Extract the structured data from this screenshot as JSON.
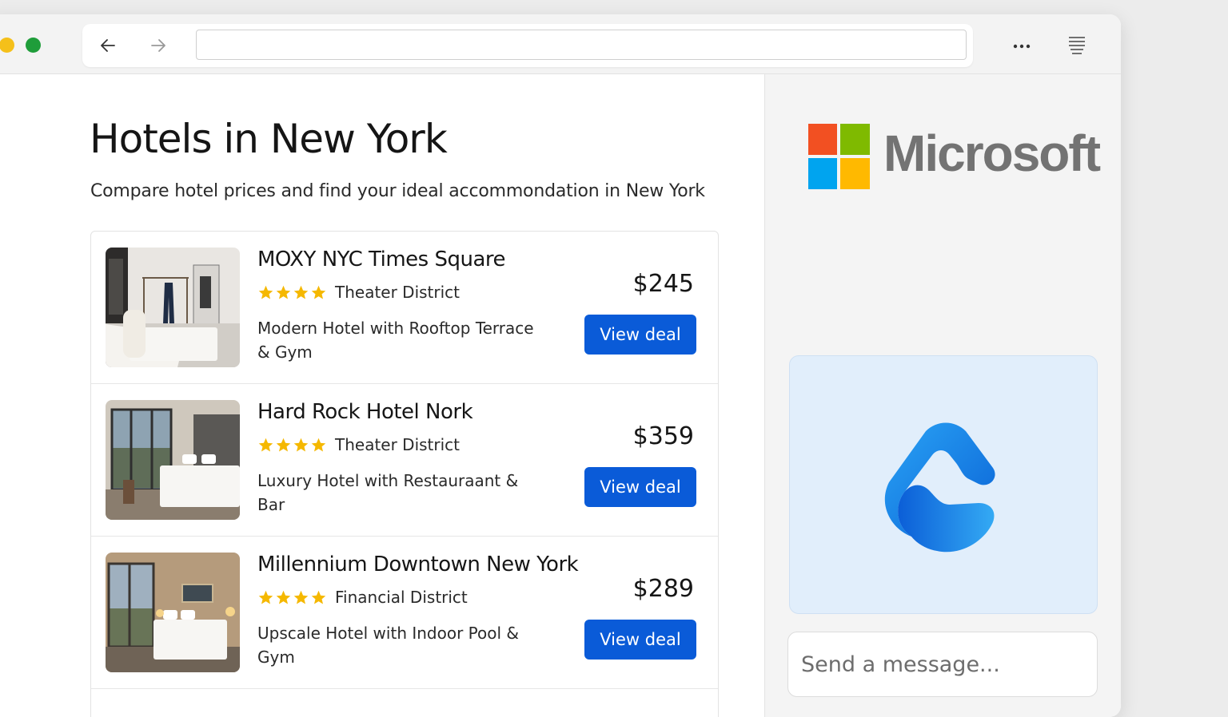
{
  "browser": {
    "address_value": "",
    "icons": [
      "back-arrow-icon",
      "forward-arrow-icon",
      "more-icon",
      "reader-icon"
    ]
  },
  "page": {
    "title": "Hotels in New York",
    "subtitle": "Compare hotel prices and find your ideal accommondation in New York"
  },
  "hotels": [
    {
      "name": "MOXY NYC Times Square",
      "stars": 4,
      "district": "Theater District",
      "description": "Modern Hotel with Rooftop Terrace & Gym",
      "price": "$245",
      "button_label": "View deal"
    },
    {
      "name": "Hard Rock Hotel Nork",
      "stars": 4,
      "district": "Theater District",
      "description": "Luxury Hotel with Restauraant  &  Bar",
      "price": "$359",
      "button_label": "View deal"
    },
    {
      "name": "Millennium Downtown New York",
      "stars": 4,
      "district": "Financial District",
      "description": "Upscale Hotel with Indoor Pool & Gym",
      "price": "$289",
      "button_label": "View deal"
    }
  ],
  "sidebar": {
    "brand": "Microsoft",
    "message_placeholder": "Send a message..."
  },
  "colors": {
    "accent": "#0a5bd8",
    "star": "#f5b800",
    "ms_red": "#f25022",
    "ms_green": "#7fba00",
    "ms_blue": "#00a4ef",
    "ms_yellow": "#ffb900"
  }
}
